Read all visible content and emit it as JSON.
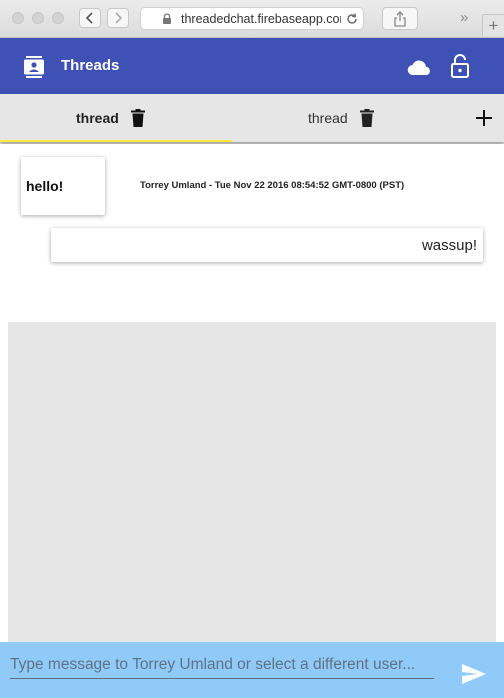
{
  "browser": {
    "url": "threadedchat.firebaseapp.com"
  },
  "appbar": {
    "title": "Threads",
    "colors": {
      "primary": "#3f51b5",
      "text": "#ffffff"
    },
    "icons": [
      "contacts-icon",
      "cloud-icon",
      "lock-open-icon"
    ]
  },
  "tabs": [
    {
      "label": "thread",
      "active": true
    },
    {
      "label": "thread",
      "active": false
    }
  ],
  "tab_indicator_color": "#ffeb3b",
  "messages": [
    {
      "text": "hello!",
      "meta": "Torrey Umland - Tue Nov 22 2016 08:54:52 GMT-0800 (PST)"
    },
    {
      "text": "wassup!"
    }
  ],
  "compose": {
    "placeholder": "Type message to Torrey Umland or select a different user...",
    "value": "",
    "background": "#90caf9"
  }
}
